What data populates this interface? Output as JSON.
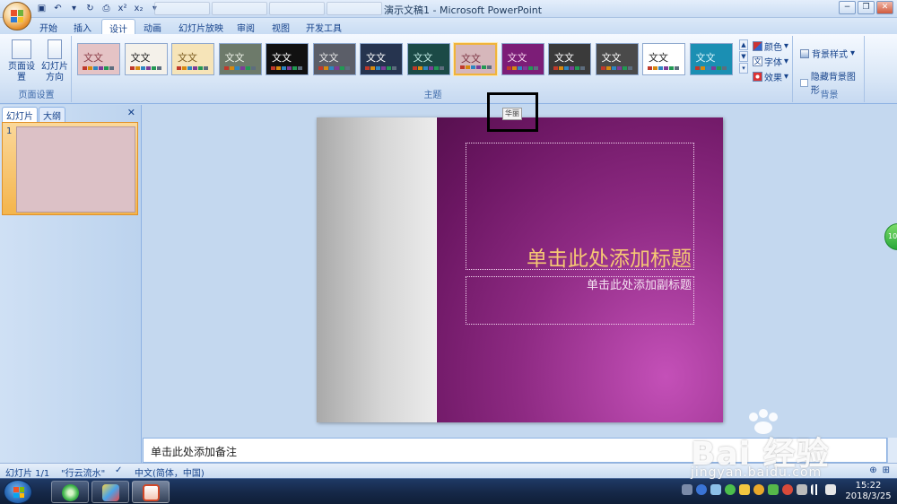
{
  "window": {
    "title": "演示文稿1 - Microsoft PowerPoint",
    "controls": {
      "minimize": "−",
      "restore": "❐",
      "close": "✕"
    }
  },
  "quick_access": [
    "save-icon",
    "undo-icon",
    "redo-icon",
    "print-preview-icon",
    "superscript-icon",
    "subscript-icon",
    "customize-icon"
  ],
  "ribbon": {
    "tabs": [
      "开始",
      "插入",
      "设计",
      "动画",
      "幻灯片放映",
      "审阅",
      "视图",
      "开发工具"
    ],
    "active_tab": "设计",
    "page_setup": {
      "label": "页面设置",
      "page_setup_btn": "页面设置",
      "orientation_btn": "幻灯片方向"
    },
    "themes": {
      "label": "主题",
      "sample_text": "文文",
      "items": [
        {
          "bg": "#e5c3c5",
          "fg": "#8a3b45",
          "selected": false
        },
        {
          "bg": "#f4f1ea",
          "fg": "#222222",
          "selected": false
        },
        {
          "bg": "#f6e4b8",
          "fg": "#7a5a1e",
          "selected": false
        },
        {
          "bg": "#6d7a6a",
          "fg": "#eef3e8",
          "selected": false
        },
        {
          "bg": "#111111",
          "fg": "#ffffff",
          "selected": false
        },
        {
          "bg": "#5b5e68",
          "fg": "#e6e6e6",
          "selected": false
        },
        {
          "bg": "#26344f",
          "fg": "#ffffff",
          "selected": false
        },
        {
          "bg": "#1b4a46",
          "fg": "#bfeae3",
          "selected": false
        },
        {
          "bg": "#d6b7bb",
          "fg": "#7b3342",
          "selected": true
        },
        {
          "bg": "#7c1d77",
          "fg": "#f6d2ee",
          "selected": false
        },
        {
          "bg": "#3a3a3a",
          "fg": "#ffffff",
          "selected": false
        },
        {
          "bg": "#4a4a4a",
          "fg": "#ffffff",
          "selected": false
        },
        {
          "bg": "#ffffff",
          "fg": "#222222",
          "selected": false
        },
        {
          "bg": "#1b8fb3",
          "fg": "#d8f4fb",
          "selected": false
        }
      ],
      "colors": "颜色",
      "fonts": "字体",
      "effects": "效果"
    },
    "background": {
      "label": "背景",
      "styles": "背景样式",
      "hide_graphics": "隐藏背景图形"
    }
  },
  "left_pane": {
    "tab_slides": "幻灯片",
    "tab_outline": "大纲",
    "close": "✕",
    "slide_number": "1"
  },
  "slide": {
    "title_placeholder": "单击此处添加标题",
    "subtitle_placeholder": "单击此处添加副标题"
  },
  "tooltip": "华丽",
  "side_badge": "10",
  "notes": {
    "placeholder": "单击此处添加备注"
  },
  "status": {
    "slide_info": "幻灯片 1/1",
    "theme_name": "\"行云流水\"",
    "language": "中文(简体，中国)"
  },
  "taskbar": {
    "time": "15:22",
    "date": "2018/3/25"
  },
  "watermark": {
    "brand": "Bai 经验",
    "url": "jingyan.baidu.com"
  }
}
